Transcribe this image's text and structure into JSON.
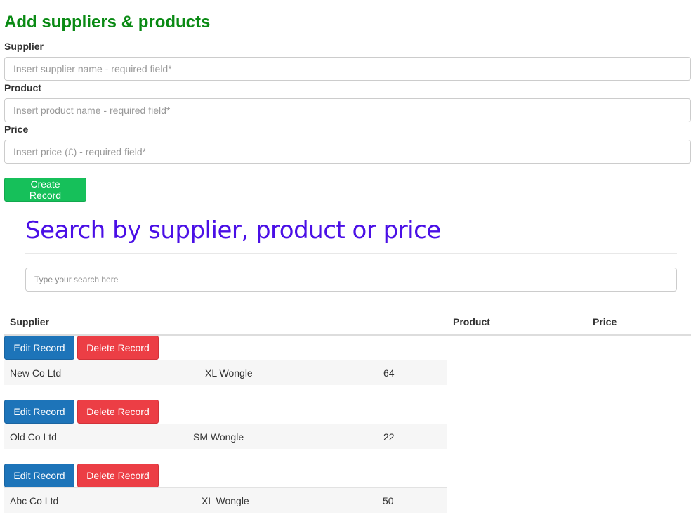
{
  "form": {
    "title": "Add suppliers & products",
    "supplier_label": "Supplier",
    "supplier_placeholder": "Insert supplier name - required field*",
    "supplier_value": "",
    "product_label": "Product",
    "product_placeholder": "Insert product name - required field*",
    "product_value": "",
    "price_label": "Price",
    "price_placeholder": "Insert price (£) - required field*",
    "price_value": "",
    "create_button": "Create Record"
  },
  "search": {
    "title": "Search by supplier, product or price",
    "placeholder": "Type your search here",
    "value": ""
  },
  "table": {
    "headers": [
      "Supplier",
      "Product",
      "Price"
    ],
    "edit_label": "Edit Record",
    "delete_label": "Delete Record",
    "rows": [
      {
        "supplier": "New Co Ltd",
        "product": "XL Wongle",
        "price": "64"
      },
      {
        "supplier": "Old Co Ltd",
        "product": "SM Wongle",
        "price": "22"
      },
      {
        "supplier": "Abc Co Ltd",
        "product": "XL Wongle",
        "price": "50"
      }
    ]
  },
  "colors": {
    "title_green": "#0a8a14",
    "search_title_purple": "#4a0fe6",
    "create_green": "#16c05a",
    "edit_blue": "#1d74b9",
    "delete_red": "#ec3e45"
  }
}
